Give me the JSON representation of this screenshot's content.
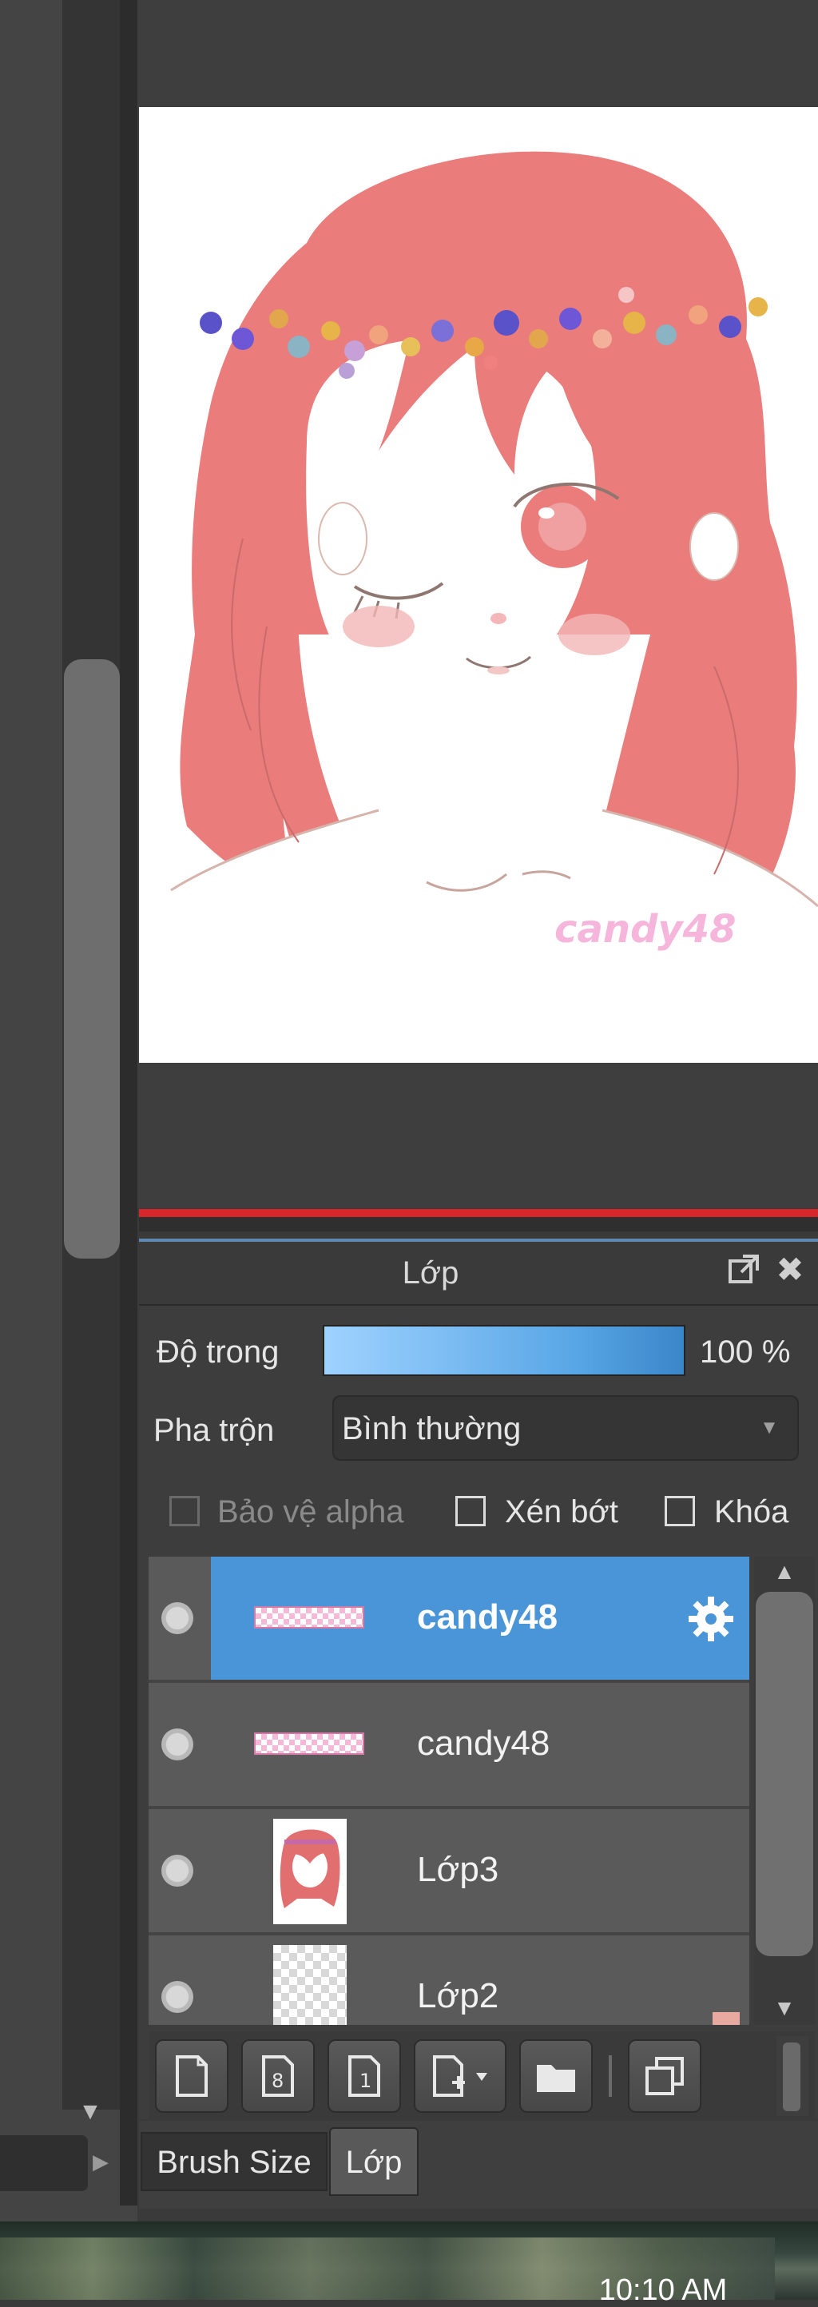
{
  "panel": {
    "title": "Lớp",
    "opacity_label": "Độ trong",
    "opacity_value": "100 %",
    "blend_label": "Pha trộn",
    "blend_value": "Bình thường",
    "checkboxes": [
      {
        "label": "Bảo vệ alpha",
        "checked": false,
        "enabled": false
      },
      {
        "label": "Xén bớt",
        "checked": false,
        "enabled": true
      },
      {
        "label": "Khóa",
        "checked": false,
        "enabled": true
      }
    ]
  },
  "layers": [
    {
      "name": "candy48",
      "selected": true
    },
    {
      "name": "candy48",
      "selected": false
    },
    {
      "name": "Lớp3",
      "selected": false
    },
    {
      "name": "Lớp2",
      "selected": false
    }
  ],
  "canvas": {
    "watermark": "candy48"
  },
  "tabs": [
    {
      "label": "Brush Size",
      "active": false
    },
    {
      "label": "Lớp",
      "active": true
    }
  ],
  "taskbar": {
    "clock": "10:10 AM"
  },
  "colors": {
    "selection": "#4a95d7",
    "accent_line": "#d8262d",
    "hair": "#ea7c7c",
    "watermark": "#f6b6dc"
  },
  "icons": {
    "detach": "detach-icon",
    "close": "close-icon",
    "gear": "gear-icon",
    "toolbar": [
      "new-layer-icon",
      "new-vector-layer-icon",
      "new-layer-from-visible-icon",
      "add-layer-dropdown-icon",
      "folder-icon",
      "duplicate-layer-icon"
    ]
  }
}
